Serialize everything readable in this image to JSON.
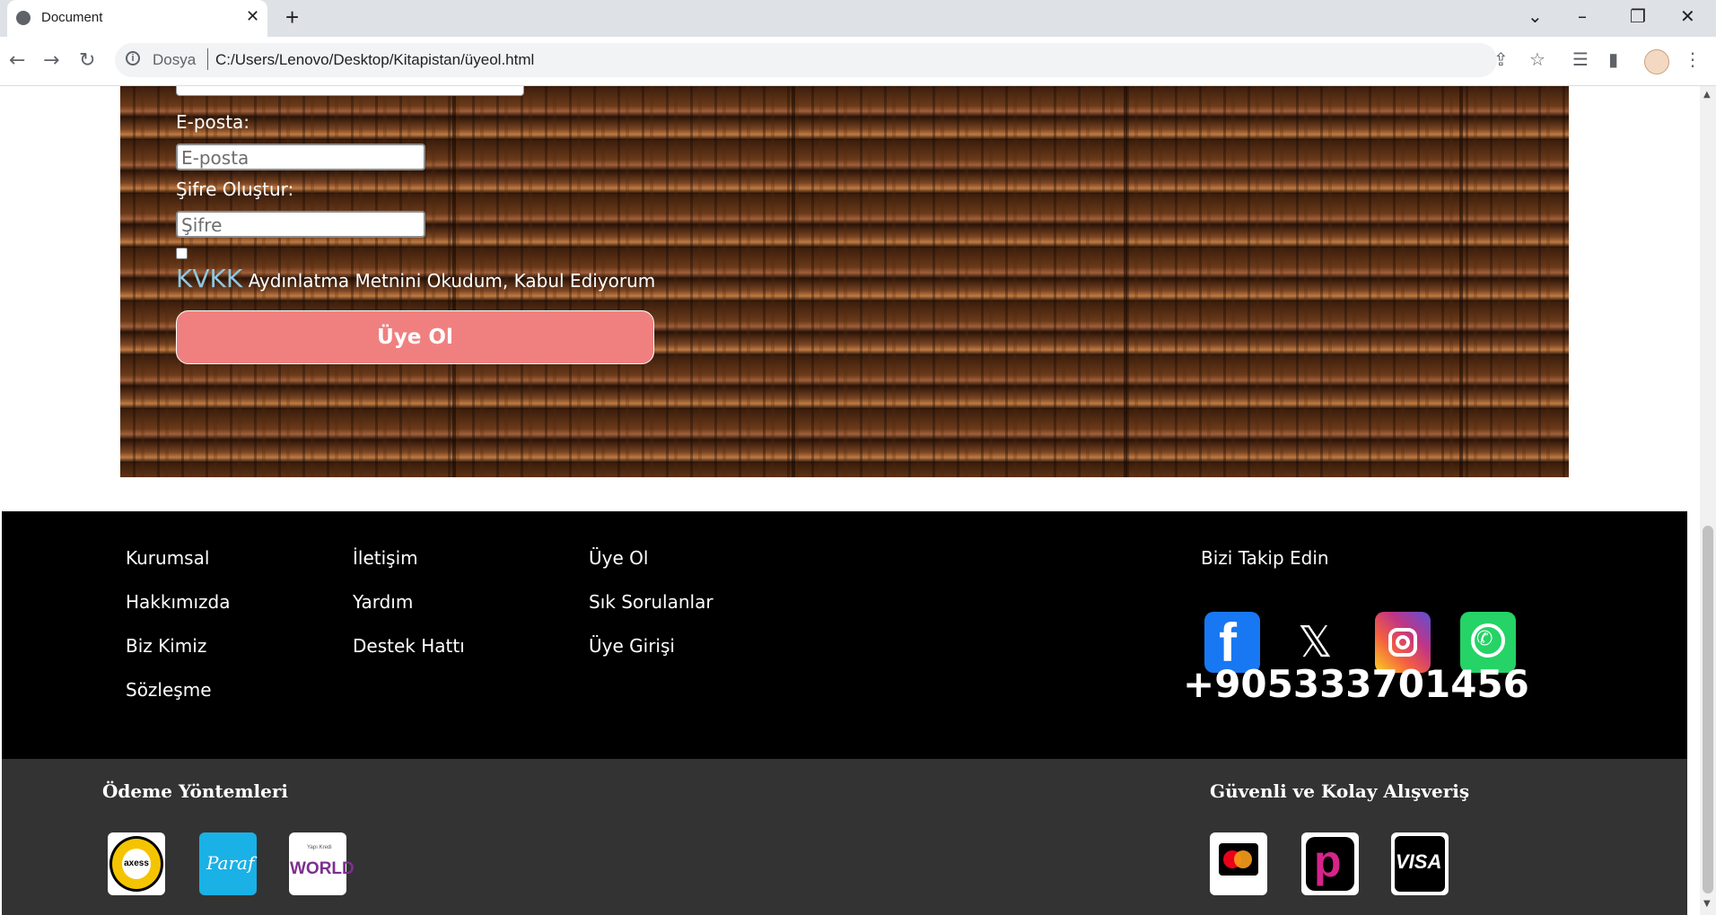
{
  "browser": {
    "tab_title": "Document",
    "tab_close": "✕",
    "new_tab": "+",
    "url_scheme": "Dosya",
    "url": "C:/Users/Lenovo/Desktop/Kitapistan/üyeol.html",
    "icons": [
      "back-icon",
      "forward-icon",
      "reload-icon",
      "info-icon",
      "share-icon",
      "star-icon",
      "reading-list-icon",
      "side-panel-icon",
      "profile-avatar",
      "menu-icon"
    ]
  },
  "form": {
    "email_label": "E-posta:",
    "email_placeholder": "E-posta",
    "password_label": "Şifre Oluştur:",
    "password_placeholder": "Şifre",
    "kvkk_link": "KVKK",
    "kvkk_text": " Aydınlatma Metnini Okudum, Kabul Ediyorum",
    "submit_label": "Üye Ol"
  },
  "footer": {
    "col1": [
      "Kurumsal",
      "Hakkımızda",
      "Biz Kimiz",
      "Sözleşme"
    ],
    "col2": [
      "İletişim",
      "Yardım",
      "Destek Hattı"
    ],
    "col3": [
      "Üye Ol",
      "Sık Sorulanlar",
      "Üye Girişi"
    ],
    "follow_title": "Bizi Takip Edin",
    "social": [
      "facebook-icon",
      "x-icon",
      "instagram-icon",
      "whatsapp-icon"
    ],
    "phone": "+905333701456",
    "payment_title": "Ödeme Yöntemleri",
    "payment_cards": {
      "axess": "axess",
      "paraf": "Paraf",
      "world_small": "Yapı Kredi",
      "world": "WORLD"
    },
    "secure_title": "Güvenli ve Kolay Alışveriş",
    "secure_cards": {
      "visa": "VISA"
    }
  },
  "colors": {
    "submit": "#f08080",
    "kvkk_link": "#8ec6df",
    "footer_top": "#000000",
    "footer_bottom": "#333333"
  }
}
